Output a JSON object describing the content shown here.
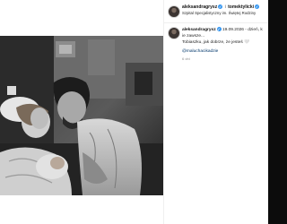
{
  "post": {
    "author": "aleksandragrysz",
    "conjunction": "i",
    "coauthor": "tomektylicki",
    "location": "Szpital Specjalistyczny im. Świętej Rodziny",
    "verified_glyph": "✓"
  },
  "caption": {
    "author": "aleksandragrysz",
    "line1_end": "19.09.2026 - dzień, k",
    "line2": "ie zawsze...",
    "line3": "Tobiaszku, jak dobrze, że jesteś",
    "emoji": "🤍",
    "mention": "@maluchacikadzie",
    "time": "6 dni"
  },
  "icons": {
    "avatar": "profile-avatar-icon",
    "verified": "verified-badge-icon"
  },
  "colors": {
    "verified": "#3797f0",
    "link": "#00376b",
    "muted": "#8e8e8e"
  }
}
